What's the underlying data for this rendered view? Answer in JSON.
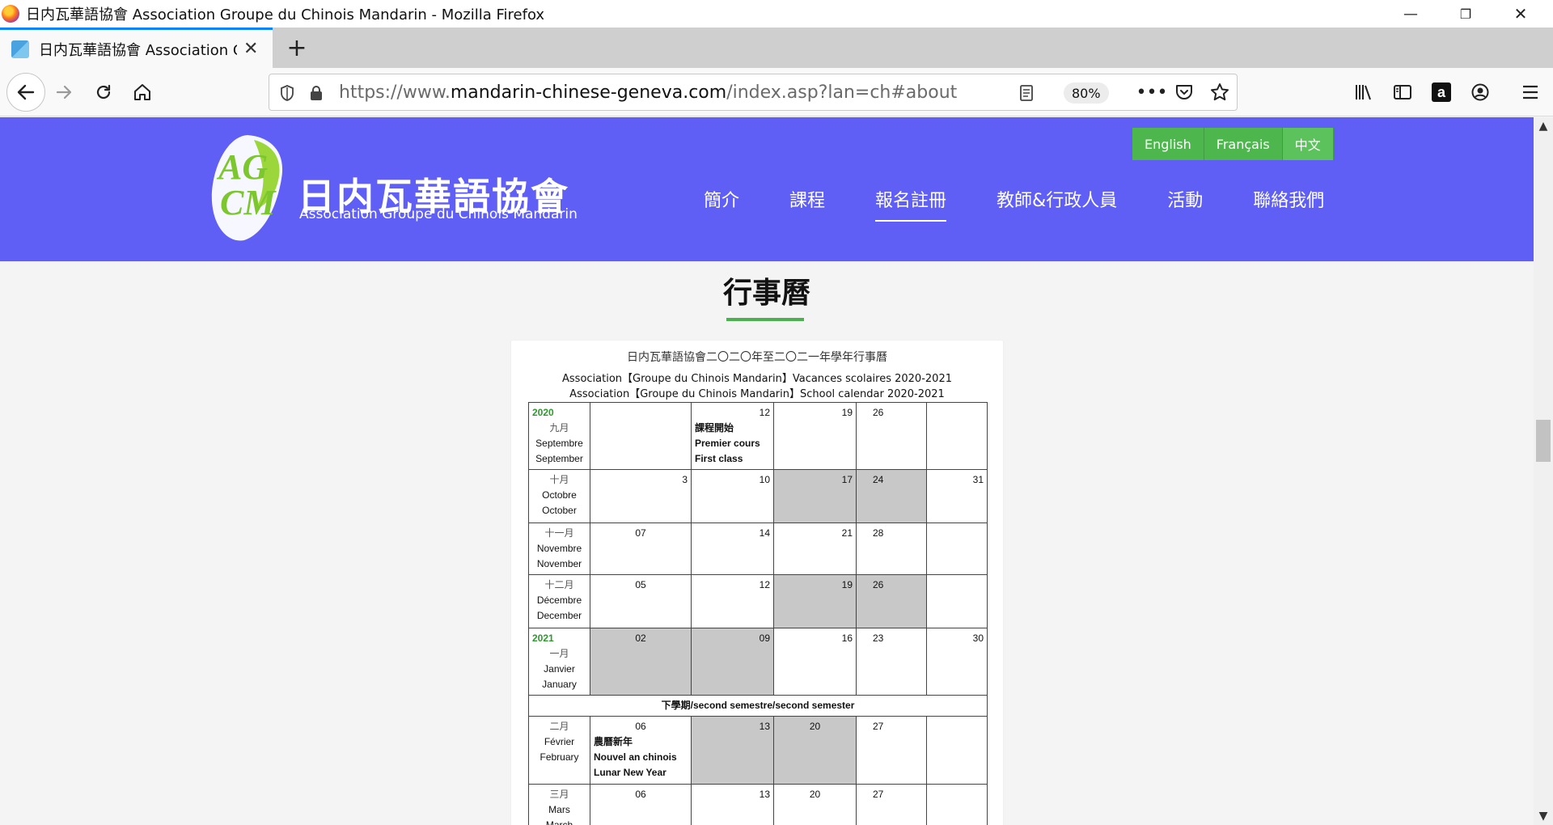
{
  "window": {
    "title": "日内瓦華語協會 Association Groupe du Chinois Mandarin - Mozilla Firefox",
    "controls": {
      "minimize": "—",
      "restore": "❐",
      "close": "✕"
    }
  },
  "tab": {
    "title": "日内瓦華語協會 Association Gr",
    "close": "✕",
    "new_tab": "+"
  },
  "nav": {
    "url_prefix": "https://www.",
    "url_domain": "mandarin-chinese-geneva.com",
    "url_path": "/index.asp?lan=ch#about",
    "zoom": "80%",
    "icons": [
      "back-icon",
      "forward-icon",
      "reload-icon",
      "home-icon",
      "shield-icon",
      "lock-icon",
      "reader-view-icon",
      "more-icon",
      "pocket-icon",
      "bookmark-star-icon",
      "library-icon",
      "sidebar-icon",
      "amazon-icon",
      "account-icon",
      "menu-icon"
    ]
  },
  "site": {
    "logo_mark": "AG CM",
    "logo_cn": "日内瓦華語協會",
    "logo_en": "Association Groupe du Chinois Mandarin",
    "languages": [
      "English",
      "Français",
      "中文"
    ],
    "active_language": "中文",
    "menu": [
      "簡介",
      "課程",
      "報名註冊",
      "教師&行政人員",
      "活動",
      "聯絡我們"
    ],
    "active_menu": "報名註冊"
  },
  "content": {
    "section_title": "行事曆",
    "calendar": {
      "heading_cn": "日内瓦華語協會二〇二〇年至二〇二一年學年行事曆",
      "heading_fr": "Association【Groupe du Chinois Mandarin】Vacances scolaires 2020-2021",
      "heading_en": "Association【Groupe du Chinois Mandarin】School calendar 2020-2021",
      "semester_label": "下學期/second semestre/second semester",
      "rows": [
        {
          "year": "2020",
          "cn": "九月",
          "fr": "Septembre",
          "en": "September",
          "days": [
            "",
            "12",
            "19",
            "26",
            ""
          ],
          "event": {
            "cn": "課程開始",
            "fr": "Premier cours",
            "en": "First class"
          }
        },
        {
          "cn": "十月",
          "fr": "Octobre",
          "en": "October",
          "days": [
            "3",
            "10",
            "17",
            "24",
            "31"
          ]
        },
        {
          "cn": "十一月",
          "fr": "Novembre",
          "en": "November",
          "days": [
            "07",
            "14",
            "21",
            "28",
            ""
          ]
        },
        {
          "cn": "十二月",
          "fr": "Décembre",
          "en": "December",
          "days": [
            "05",
            "12",
            "19",
            "26",
            ""
          ]
        },
        {
          "year": "2021",
          "cn": "一月",
          "fr": "Janvier",
          "en": "January",
          "days": [
            "02",
            "09",
            "16",
            "23",
            "30"
          ]
        },
        {
          "cn": "二月",
          "fr": "Février",
          "en": "February",
          "days": [
            "06",
            "13",
            "20",
            "27",
            ""
          ],
          "event": {
            "cn": "農曆新年",
            "fr": "Nouvel an chinois",
            "en": "Lunar New Year"
          }
        },
        {
          "cn": "三月",
          "fr": "Mars",
          "en": "March",
          "days": [
            "06",
            "13",
            "20",
            "27",
            ""
          ]
        }
      ]
    }
  },
  "colors": {
    "header_bg": "#5f5ef5",
    "lang_btn": "#4db74d",
    "accent_underline": "#4caf50",
    "holiday_gray": "#c8c8c8",
    "year_green": "#2e9a2e"
  }
}
